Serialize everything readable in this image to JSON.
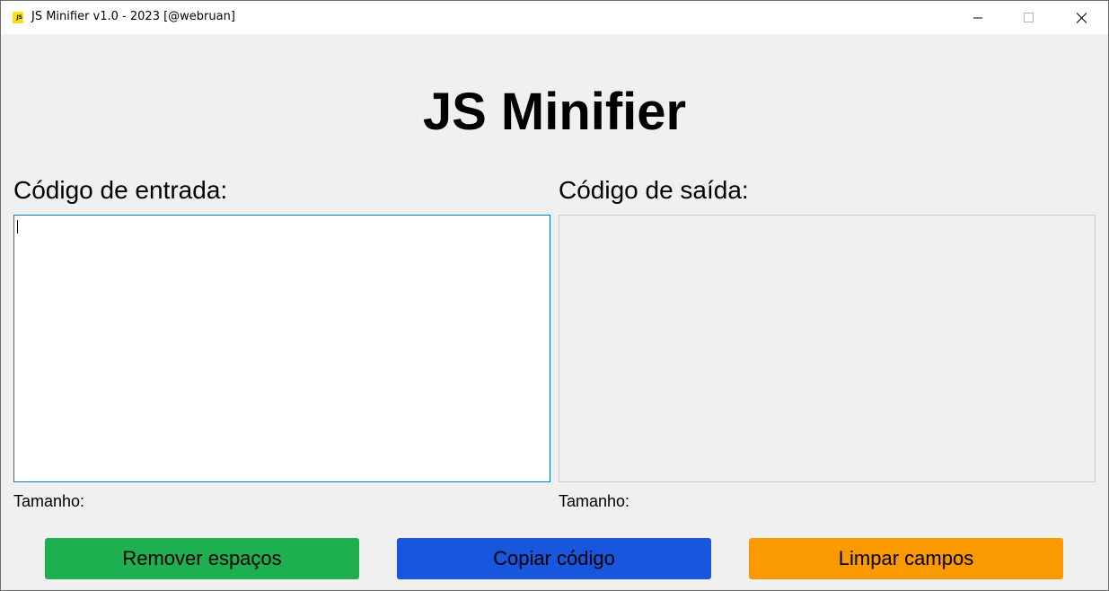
{
  "window": {
    "title": "JS Minifier v1.0 - 2023 [@webruan]",
    "icon_text": "JS",
    "icon": "js-logo-icon",
    "controls": [
      "minimize-icon",
      "maximize-icon",
      "close-icon"
    ]
  },
  "header": {
    "title": "JS Minifier"
  },
  "input_panel": {
    "label": "Código de entrada:",
    "value": "",
    "size_label": "Tamanho:"
  },
  "output_panel": {
    "label": "Código de saída:",
    "value": "",
    "size_label": "Tamanho:"
  },
  "buttons": {
    "remove_spaces": "Remover espaços",
    "copy_code": "Copiar código",
    "clear_fields": "Limpar campos"
  },
  "colors": {
    "remove_spaces": "#1eaf50",
    "copy_code": "#1857dd",
    "clear_fields": "#fa9900",
    "input_focus_border": "#0078d7",
    "window_background": "#f0f0f0"
  }
}
